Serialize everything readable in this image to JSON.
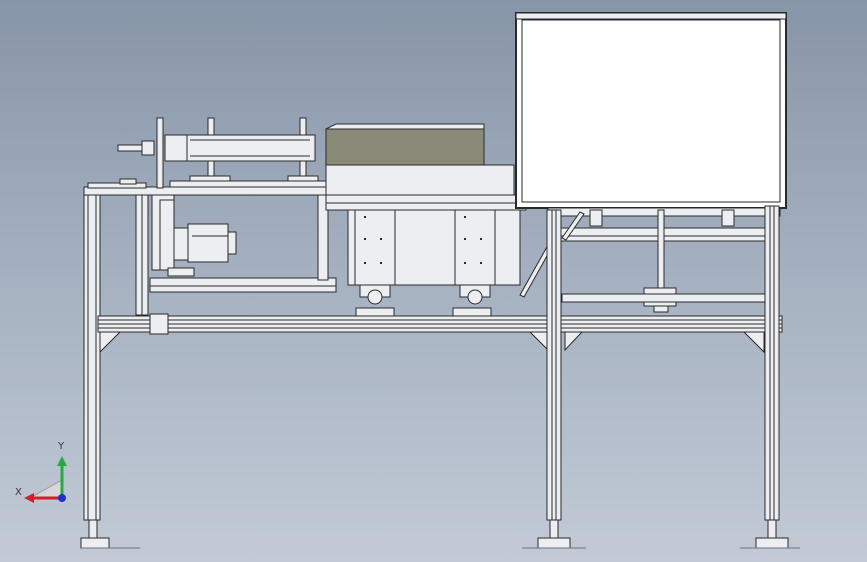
{
  "viewport": {
    "background_top": "#8795a8",
    "background_bottom": "#c2cad6"
  },
  "triad": {
    "x_label": "X",
    "y_label": "Y",
    "x_color": "#d0202a",
    "y_color": "#2aa844",
    "z_color": "#2030c8"
  },
  "colors": {
    "frame_fill": "#eceef1",
    "edge": "#2a2a2a",
    "hopper_top": "#8a8a78",
    "screen_fill": "#ffffff"
  }
}
